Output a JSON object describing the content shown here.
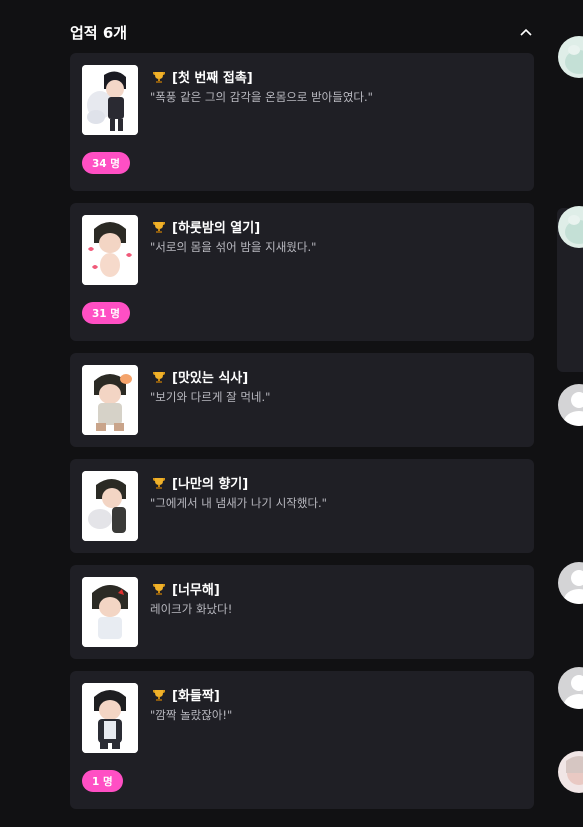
{
  "section": {
    "title": "업적 6개"
  },
  "achievements": [
    {
      "title": "[첫 번째 접촉]",
      "desc": "\"폭풍 같은 그의 감각을 온몸으로 받아들였다.\"",
      "count": "34 명"
    },
    {
      "title": "[하룻밤의 열기]",
      "desc": "\"서로의 몸을 섞어 밤을 지새웠다.\"",
      "count": "31 명"
    },
    {
      "title": "[맛있는 식사]",
      "desc": "\"보기와 다르게 잘 먹네.\"",
      "count": ""
    },
    {
      "title": "[나만의 향기]",
      "desc": "\"그에게서 내 냄새가 나기 시작했다.\"",
      "count": ""
    },
    {
      "title": "[너무해]",
      "desc": "레이크가 화났다!",
      "count": ""
    },
    {
      "title": "[화들짝]",
      "desc": "\"깜짝 놀랐잖아!\"",
      "count": "1 명"
    }
  ],
  "colors": {
    "background": "#111113",
    "card": "#1f1f25",
    "badge": "#ff4fc4",
    "desc_text": "#b9b9c0"
  },
  "icons": {
    "trophy": "trophy-icon",
    "collapse": "chevron-up-icon",
    "default_avatar": "user-silhouette-icon"
  }
}
